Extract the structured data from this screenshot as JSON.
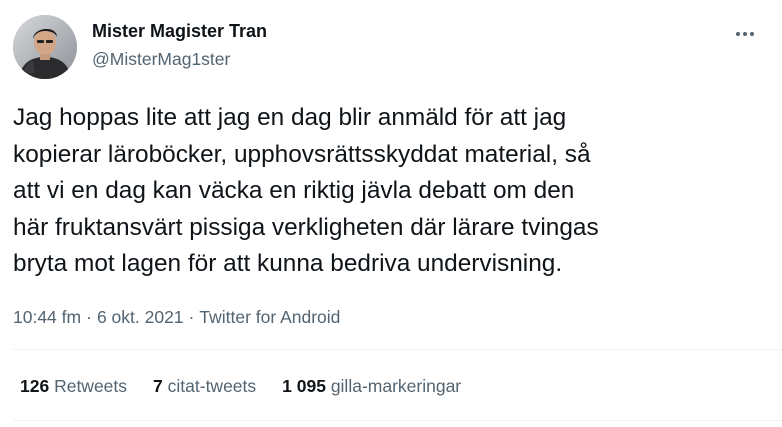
{
  "author": {
    "display_name": "Mister Magister Tran",
    "handle": "@MisterMag1ster"
  },
  "more_icon": "ellipsis-icon",
  "tweet": {
    "lines": [
      "Jag hoppas lite att jag en dag blir anmäld för att jag",
      "kopierar läroböcker, upphovsrättsskyddat material, så",
      "att vi en dag kan väcka en riktig jävla debatt om den",
      "här fruktansvärt pissiga verkligheten där lärare tvingas",
      "bryta mot lagen för att kunna bedriva undervisning."
    ]
  },
  "meta": {
    "time": "10:44 fm",
    "separator": "·",
    "date": "6 okt. 2021",
    "source": "Twitter for Android"
  },
  "stats": {
    "retweets": {
      "count": "126",
      "label": "Retweets"
    },
    "quotes": {
      "count": "7",
      "label": "citat-tweets"
    },
    "likes": {
      "count": "1 095",
      "label": "gilla-markeringar"
    }
  },
  "colors": {
    "text": "#0f1419",
    "secondary": "#536471",
    "divider": "#eff3f4"
  }
}
